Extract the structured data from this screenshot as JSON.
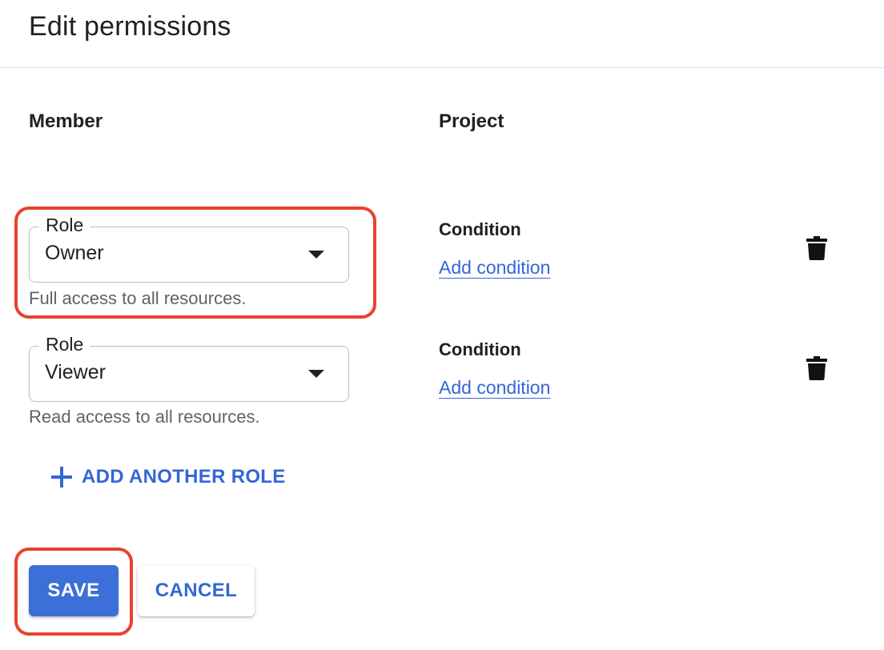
{
  "header": {
    "title": "Edit permissions"
  },
  "columns": {
    "member": "Member",
    "project": "Project"
  },
  "roles": [
    {
      "legend": "Role",
      "value": "Owner",
      "helper": "Full access to all resources.",
      "condition_label": "Condition",
      "condition_link": "Add condition",
      "delete_icon": "trash-icon"
    },
    {
      "legend": "Role",
      "value": "Viewer",
      "helper": "Read access to all resources.",
      "condition_label": "Condition",
      "condition_link": "Add condition",
      "delete_icon": "trash-icon"
    }
  ],
  "add_role": {
    "label": "ADD ANOTHER ROLE",
    "icon": "plus-icon"
  },
  "actions": {
    "save_label": "SAVE",
    "cancel_label": "CANCEL"
  },
  "colors": {
    "accent": "#3367d6",
    "save_button": "#3c6fd7",
    "highlight": "#e8422e",
    "helper_text": "#5f6368"
  }
}
